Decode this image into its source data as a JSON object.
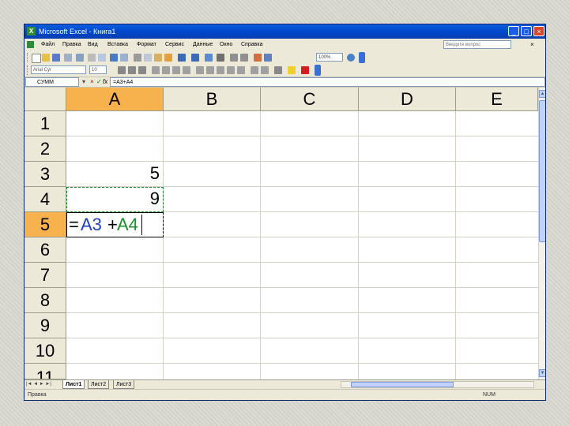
{
  "window": {
    "title": "Microsoft Excel - Книга1",
    "app_icon": "X",
    "controls": {
      "minimize": "_",
      "maximize": "□",
      "close": "×"
    }
  },
  "menu": {
    "items": [
      "Файл",
      "Правка",
      "Вид",
      "Вставка",
      "Формат",
      "Сервис",
      "Данные",
      "Окно",
      "Справка"
    ],
    "help_placeholder": "Введите вопрос",
    "doc_close": "× "
  },
  "toolbar": {
    "zoom": "100%",
    "font_name": "Arial Cyr",
    "font_size": "10"
  },
  "formula_bar": {
    "name_box": "СУММ",
    "cancel_icon": "×",
    "enter_icon": "✓",
    "fx_label": "fx",
    "content": "=A3+A4"
  },
  "sheet": {
    "columns": [
      "A",
      "B",
      "C",
      "D",
      "E"
    ],
    "rows": [
      "1",
      "2",
      "3",
      "4",
      "5",
      "6",
      "7",
      "8",
      "9",
      "10",
      "11"
    ],
    "selected_column": "A",
    "selected_row": "5",
    "cells": {
      "A3": "5",
      "A4": "9"
    },
    "active_cell_formula": {
      "equals": "=",
      "ref1": "A3",
      "plus": "+",
      "ref2": "A4",
      "ref1_color": "#1f3fbf",
      "ref2_color": "#1a8f2a"
    }
  },
  "tabs": {
    "nav": "|◄ ◄ ► ►|",
    "sheets": [
      "Лист1",
      "Лист2",
      "Лист3"
    ],
    "active": "Лист1"
  },
  "status": {
    "left": "Правка",
    "right": "NUM"
  },
  "colors": {
    "selected_header": "#f7b24d",
    "title_bar": "#0a5ee0",
    "header_bg": "#ece9d8"
  }
}
